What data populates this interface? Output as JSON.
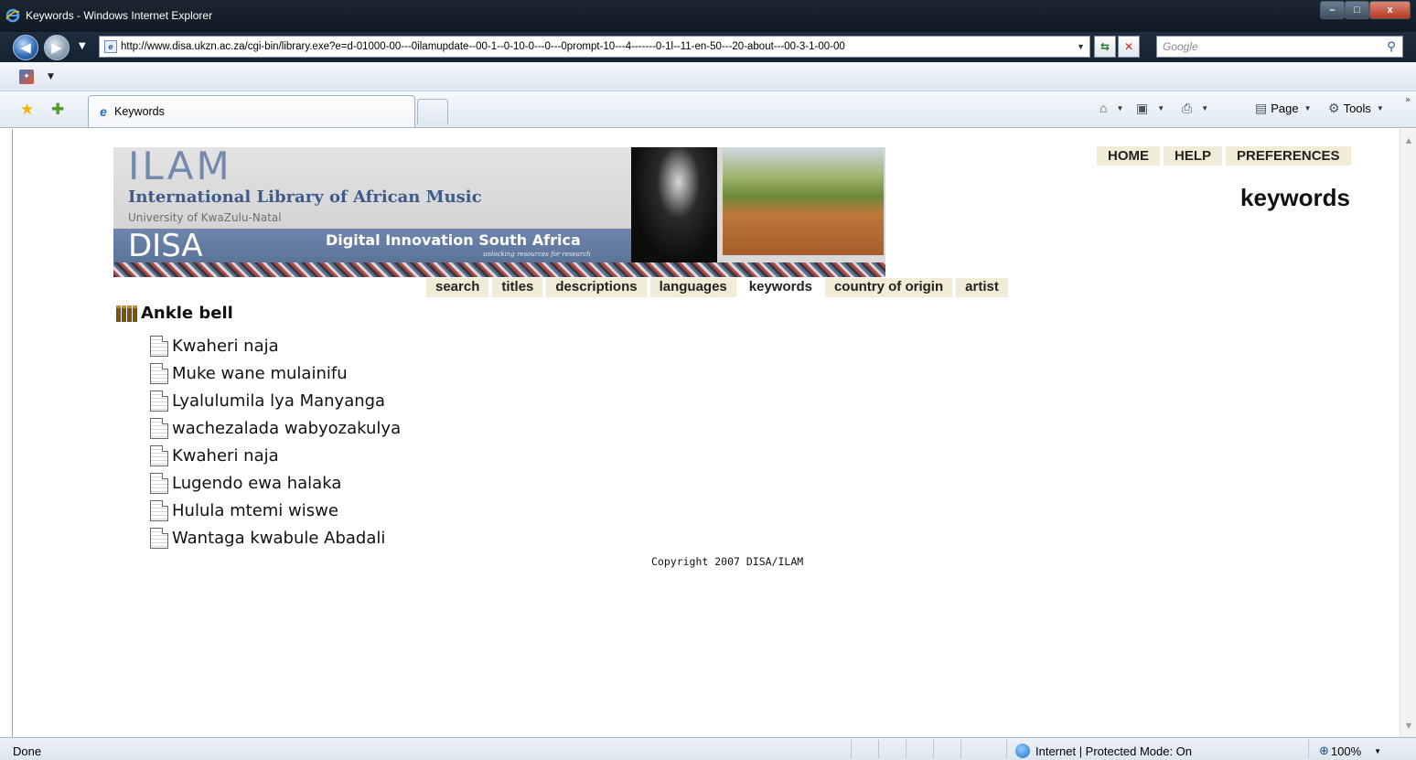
{
  "window": {
    "title": "Keywords - Windows Internet Explorer",
    "min_label": "–",
    "max_label": "□",
    "close_label": "x"
  },
  "address": {
    "url": "http://www.disa.ukzn.ac.za/cgi-bin/library.exe?e=d-01000-00---0ilamupdate--00-1--0-10-0---0---0prompt-10---4-------0-1l--11-en-50---20-about---00-3-1-00-00",
    "search_placeholder": "Google"
  },
  "tab": {
    "label": "Keywords"
  },
  "commandbar": {
    "page_label": "Page",
    "tools_label": "Tools"
  },
  "banner": {
    "ilam": "ILAM",
    "intl": "International Library of African Music",
    "univ": "University of KwaZulu-Natal",
    "disa": "DISA",
    "dis": "Digital Innovation South Africa",
    "unlocking": "unlocking resources for research"
  },
  "topnav": [
    "HOME",
    "HELP",
    "PREFERENCES"
  ],
  "page_title": "keywords",
  "navtabs": [
    "search",
    "titles",
    "descriptions",
    "languages",
    "keywords",
    "country of origin",
    "artist"
  ],
  "active_tab": "keywords",
  "section": {
    "heading": "Ankle bell",
    "items": [
      "Kwaheri naja",
      "Muke wane mulainifu",
      "Lyalulumila lya Manyanga",
      "wachezalada wabyozakulya",
      "Kwaheri naja",
      "Lugendo ewa halaka",
      "Hulula mtemi wiswe",
      "Wantaga kwabule Abadali"
    ]
  },
  "copyright": "Copyright 2007 DISA/ILAM",
  "status": {
    "text": "Done",
    "zone": "Internet | Protected Mode: On",
    "zoom": "100%"
  }
}
